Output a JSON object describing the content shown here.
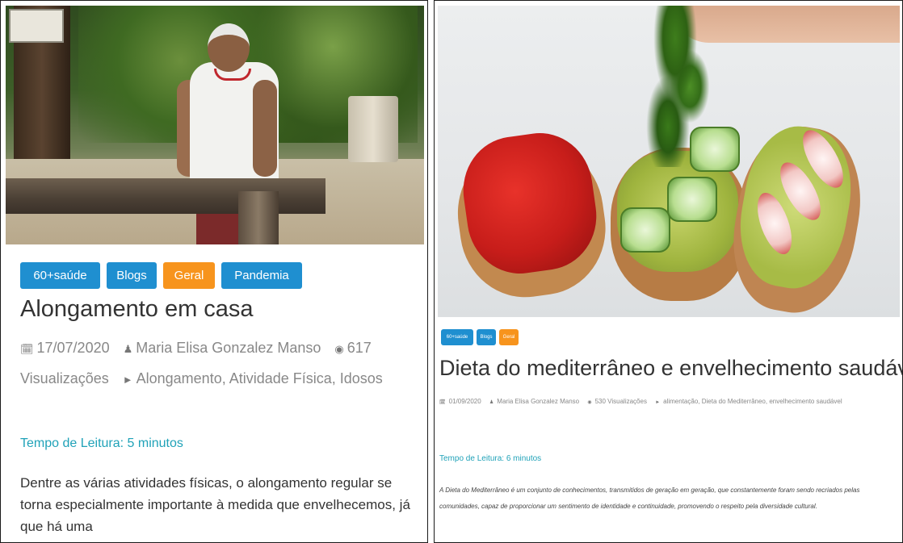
{
  "post1": {
    "tags": [
      "60+saúde",
      "Blogs",
      "Geral",
      "Pandemia"
    ],
    "title": "Alongamento em casa",
    "date": "17/07/2020",
    "author": "Maria Elisa Gonzalez Manso",
    "views": "617 Visualizações",
    "keywords": "Alongamento, Atividade Física, Idosos",
    "reading_time": "Tempo de Leitura: 5 minutos",
    "excerpt": "Dentre as várias atividades físicas, o alongamento regular se torna especialmente importante à medida que envelhecemos, já que há uma",
    "icons": {
      "date": "calendar-icon",
      "author": "user-icon",
      "views": "eye-icon",
      "keywords": "tag-icon"
    }
  },
  "post2": {
    "tags": [
      "60+saúde",
      "Blogs",
      "Geral"
    ],
    "title": "Dieta do mediterrâneo e envelhecimento saudável",
    "date": "01/09/2020",
    "author": "Maria Elisa Gonzalez Manso",
    "views": "530 Visualizações",
    "keywords": "alimentação, Dieta do Mediterrâneo, envelhecimento saudável",
    "reading_time": "Tempo de Leitura: 6 minutos",
    "excerpt": "A Dieta do Mediterrâneo é um conjunto de conhecimentos, transmitidos de geração em geração, que constantemente foram sendo recriados pelas comunidades, capaz de proporcionar um sentimento de identidade e continuidade, promovendo o respeito pela diversidade cultural.",
    "icons": {
      "date": "calendar-icon",
      "author": "user-icon",
      "views": "eye-icon",
      "keywords": "tag-icon"
    }
  },
  "colors": {
    "tag_blue": "#1f8fd0",
    "tag_orange": "#f7941d",
    "reading_time": "#20a2b8"
  }
}
